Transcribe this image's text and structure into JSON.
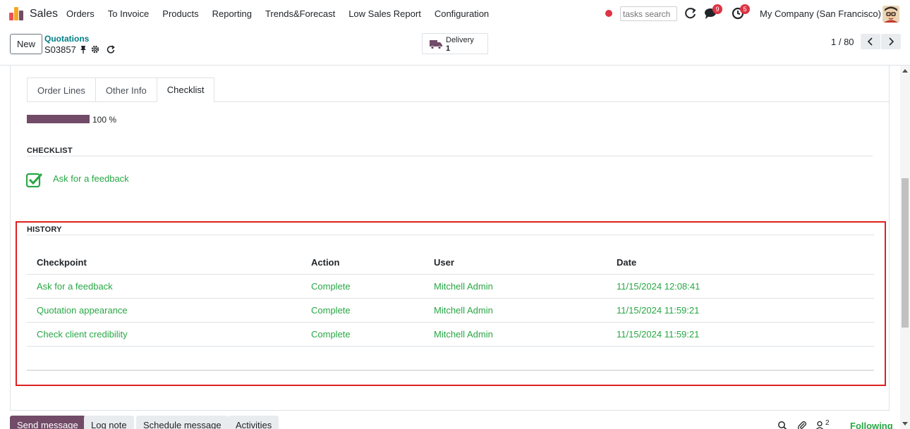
{
  "navbar": {
    "app_name": "Sales",
    "menu": [
      "Orders",
      "To Invoice",
      "Products",
      "Reporting",
      "Trends&Forecast",
      "Low Sales Report",
      "Configuration"
    ],
    "search_placeholder": "tasks search",
    "messages_badge": "9",
    "activities_badge": "5",
    "company": "My Company (San Francisco)"
  },
  "control": {
    "new_label": "New",
    "breadcrumb": "Quotations",
    "record_name": "S03857",
    "smart_button": {
      "label": "Delivery",
      "value": "1"
    },
    "pager": "1 / 80"
  },
  "tabs": [
    "Order Lines",
    "Other Info",
    "Checklist"
  ],
  "active_tab": "Checklist",
  "checklist": {
    "progress_value": 1.0,
    "progress_text": "100 %",
    "section_title": "CHECKLIST",
    "items": [
      {
        "label": "Ask for a feedback",
        "checked": true
      }
    ]
  },
  "history": {
    "section_title": "HISTORY",
    "columns": [
      "Checkpoint",
      "Action",
      "User",
      "Date"
    ],
    "rows": [
      [
        "Ask for a feedback",
        "Complete",
        "Mitchell Admin",
        "11/15/2024 12:08:41"
      ],
      [
        "Quotation appearance",
        "Complete",
        "Mitchell Admin",
        "11/15/2024 11:59:21"
      ],
      [
        "Check client credibility",
        "Complete",
        "Mitchell Admin",
        "11/15/2024 11:59:21"
      ]
    ]
  },
  "chatter": {
    "send_message": "Send message",
    "log_note": "Log note",
    "schedule_message": "Schedule message",
    "activities": "Activities",
    "followers_count": "2",
    "following": "Following"
  },
  "colors": {
    "brand": "#714b67",
    "link": "#017e84",
    "success": "#28a745",
    "highlight": "#e02020"
  }
}
